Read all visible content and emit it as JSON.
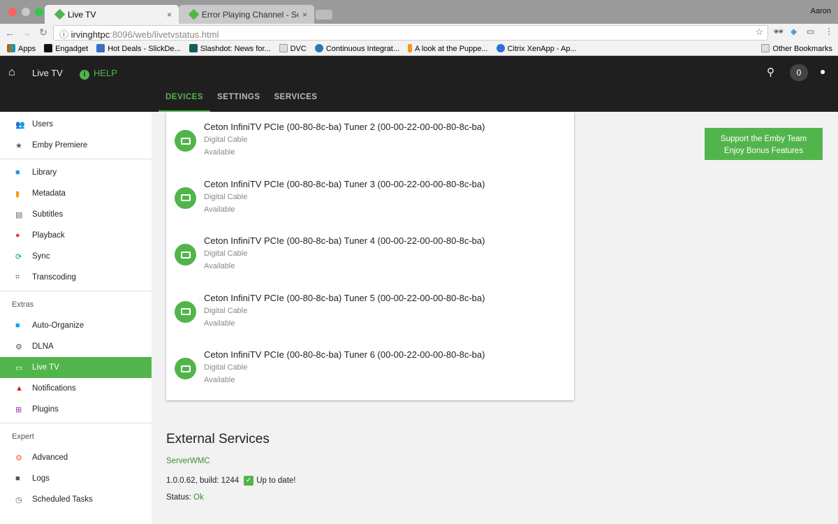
{
  "browser": {
    "tabs": [
      {
        "label": "Live TV"
      },
      {
        "label": "Error Playing Channel - Server"
      }
    ],
    "user": "Aaron",
    "url_host": "irvinghtpc",
    "url_rest": ":8096/web/livetvstatus.html",
    "bookmarks": [
      "Apps",
      "Engadget",
      "Hot Deals - SlickDe...",
      "Slashdot: News for...",
      "DVC",
      "Continuous Integrat...",
      "A look at the Puppe...",
      "Citrix XenApp - Ap..."
    ],
    "other_bookmarks": "Other Bookmarks"
  },
  "header": {
    "title": "Live TV",
    "help": "HELP",
    "notif_count": "0",
    "tabs": [
      "DEVICES",
      "SETTINGS",
      "SERVICES"
    ]
  },
  "sidebar": {
    "items": [
      {
        "label": "Users",
        "icon": "users-icon",
        "color": "#666"
      },
      {
        "label": "Emby Premiere",
        "icon": "star-icon",
        "color": "#555"
      },
      {
        "sep": true
      },
      {
        "label": "Library",
        "icon": "folder-icon",
        "color": "#2196f3"
      },
      {
        "label": "Metadata",
        "icon": "file-icon",
        "color": "#ff9800"
      },
      {
        "label": "Subtitles",
        "icon": "subtitles-icon",
        "color": "#666"
      },
      {
        "label": "Playback",
        "icon": "play-icon",
        "color": "#e53935"
      },
      {
        "label": "Sync",
        "icon": "sync-icon",
        "color": "#009688"
      },
      {
        "label": "Transcoding",
        "icon": "crop-icon",
        "color": "#555"
      },
      {
        "sep": true
      },
      {
        "header": "Extras"
      },
      {
        "label": "Auto-Organize",
        "icon": "folder-icon",
        "color": "#03a9f4"
      },
      {
        "label": "DLNA",
        "icon": "gear-icon",
        "color": "#555"
      },
      {
        "label": "Live TV",
        "icon": "tv-icon",
        "color": "#fff",
        "active": true
      },
      {
        "label": "Notifications",
        "icon": "bell-icon",
        "color": "#c62828"
      },
      {
        "label": "Plugins",
        "icon": "cart-icon",
        "color": "#9c27b0"
      },
      {
        "sep": true
      },
      {
        "header": "Expert"
      },
      {
        "label": "Advanced",
        "icon": "gear-icon",
        "color": "#ff5722"
      },
      {
        "label": "Logs",
        "icon": "folder-icon",
        "color": "#555"
      },
      {
        "label": "Scheduled Tasks",
        "icon": "clock-icon",
        "color": "#555"
      }
    ]
  },
  "devices": [
    {
      "name": "Ceton InfiniTV PCIe (00-80-8c-ba) Tuner 2 (00-00-22-00-00-80-8c-ba)",
      "type": "Digital Cable",
      "status": "Available"
    },
    {
      "name": "Ceton InfiniTV PCIe (00-80-8c-ba) Tuner 3 (00-00-22-00-00-80-8c-ba)",
      "type": "Digital Cable",
      "status": "Available"
    },
    {
      "name": "Ceton InfiniTV PCIe (00-80-8c-ba) Tuner 4 (00-00-22-00-00-80-8c-ba)",
      "type": "Digital Cable",
      "status": "Available"
    },
    {
      "name": "Ceton InfiniTV PCIe (00-80-8c-ba) Tuner 5 (00-00-22-00-00-80-8c-ba)",
      "type": "Digital Cable",
      "status": "Available"
    },
    {
      "name": "Ceton InfiniTV PCIe (00-80-8c-ba) Tuner 6 (00-00-22-00-00-80-8c-ba)",
      "type": "Digital Cable",
      "status": "Available"
    }
  ],
  "promo": {
    "line1": "Support the Emby Team",
    "line2": "Enjoy Bonus Features"
  },
  "external": {
    "title": "External Services",
    "service": "ServerWMC",
    "version": "1.0.0.62, build: 1244",
    "uptodate": "Up to date!",
    "status_label": "Status:",
    "status_value": "Ok"
  },
  "colors": {
    "accent": "#52b54b"
  }
}
